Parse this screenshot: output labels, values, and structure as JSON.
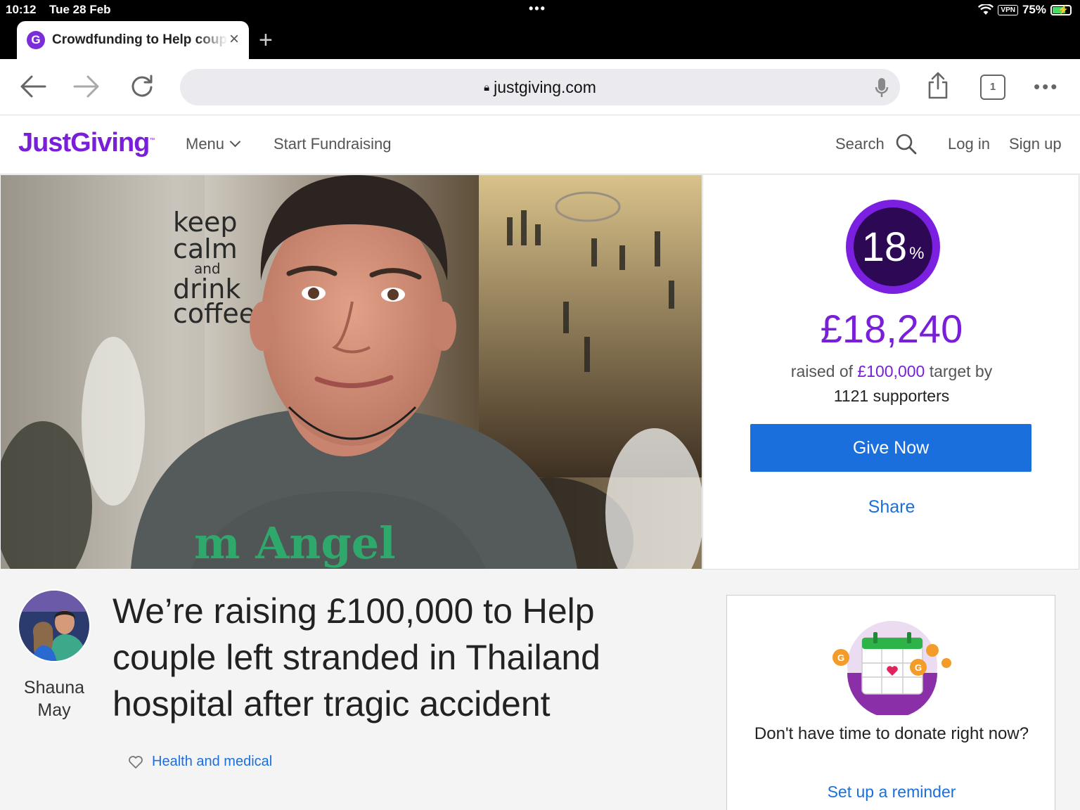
{
  "status_bar": {
    "time": "10:12",
    "date": "Tue 28 Feb",
    "vpn": "VPN",
    "battery": "75%"
  },
  "tab": {
    "favicon": "G",
    "title": "Crowdfunding to Help couple left stranded",
    "close_icon": "×",
    "new_tab_icon": "+"
  },
  "toolbar": {
    "url": "justgiving.com",
    "tab_count": "1"
  },
  "site": {
    "logo": "JustGiving",
    "logo_tm": "™",
    "nav": {
      "menu": "Menu",
      "start_fundraising": "Start Fundraising",
      "search": "Search",
      "login": "Log in",
      "signup": "Sign up"
    }
  },
  "stats": {
    "percent": "18",
    "percent_sign": "%",
    "progress_fraction": 0.18,
    "amount_raised": "£18,240",
    "raised_of": "raised of",
    "target": "£100,000",
    "target_by": "target by",
    "supporters": "1121 supporters",
    "give_button": "Give Now",
    "share_link": "Share"
  },
  "page": {
    "organizer_name": "Shauna May",
    "headline": "We’re raising £100,000 to Help couple left stranded in Thailand hospital after tragic accident",
    "category": "Health and medical"
  },
  "reminder": {
    "text": "Don't have time to donate right now?",
    "link": "Set up a reminder"
  },
  "colors": {
    "brand_purple": "#7a1fd9",
    "button_blue": "#1a6fdc"
  }
}
